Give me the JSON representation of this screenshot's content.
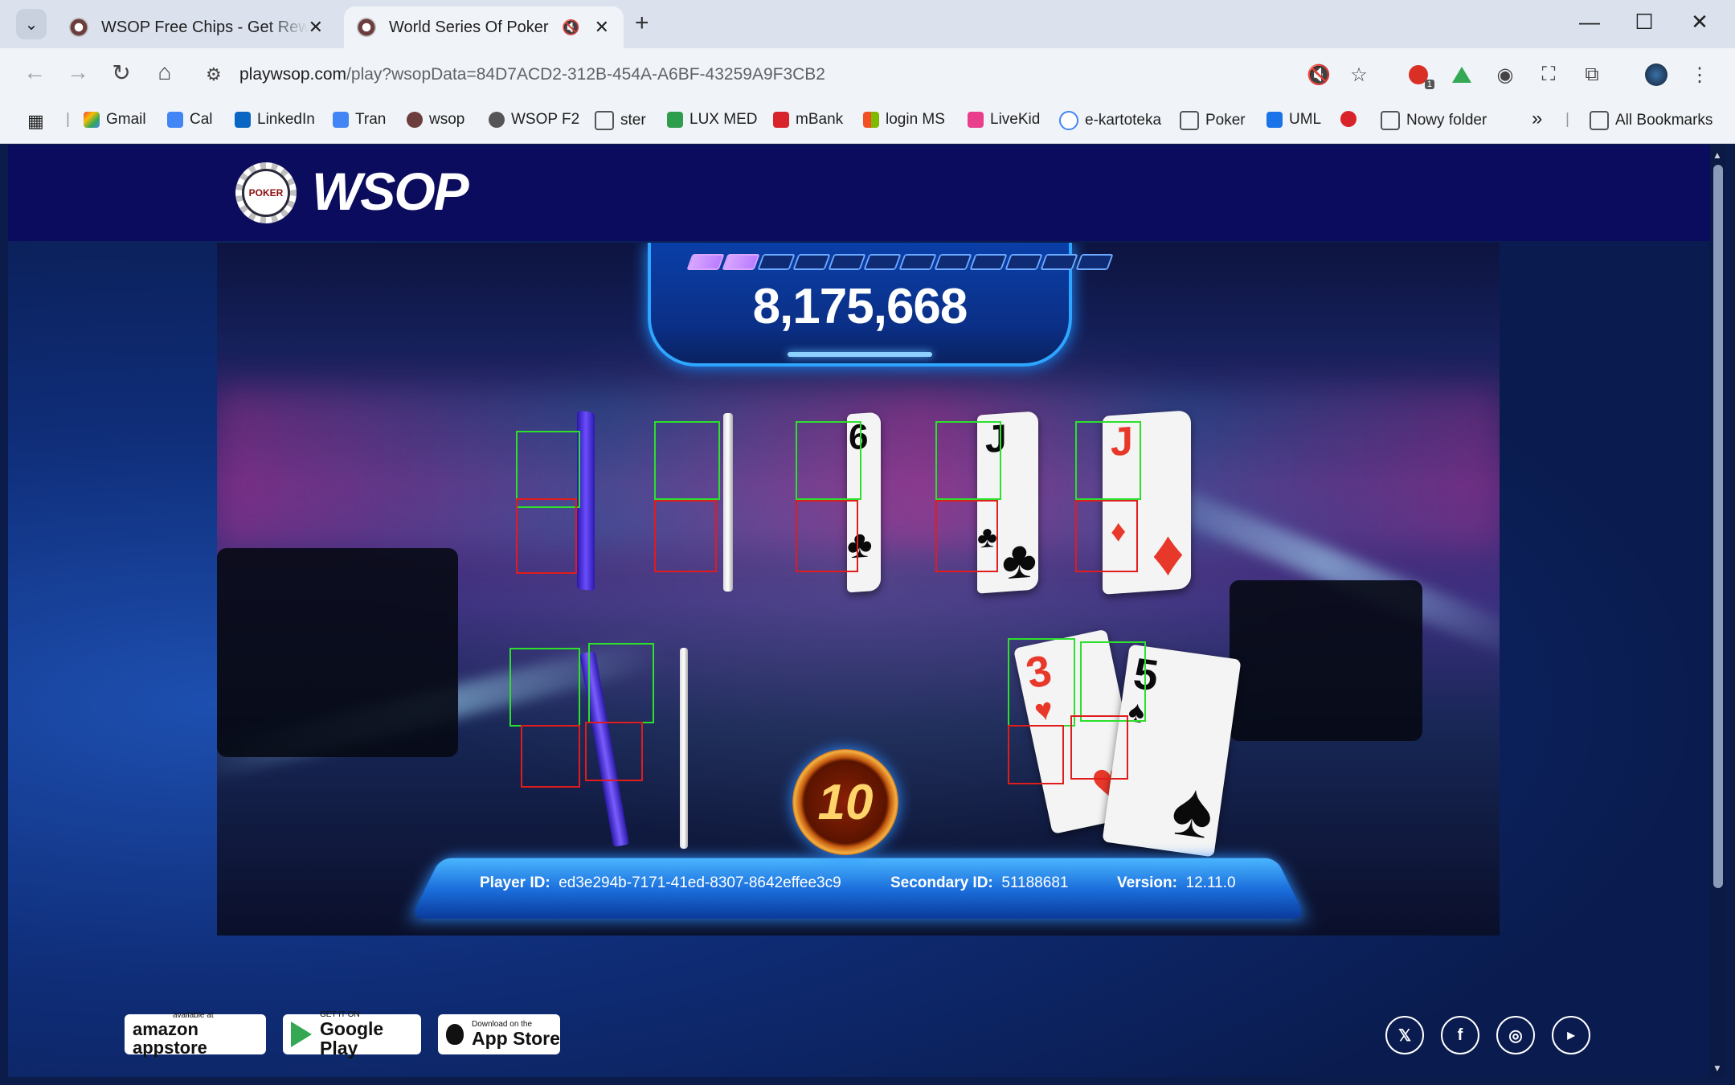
{
  "browser": {
    "tabs": [
      {
        "title": "WSOP Free Chips - Get Rewards",
        "active": false
      },
      {
        "title": "World Series Of Poker",
        "active": true
      }
    ],
    "url_domain": "playwsop.com",
    "url_path": "/play?wsopData=84D7ACD2-312B-454A-A6BF-43259A9F3CB2",
    "extension_badge": "1",
    "bookmarks": [
      "Gmail",
      "Cal",
      "LinkedIn",
      "Tran",
      "wsop",
      "WSOP F2",
      "ster",
      "LUX MED",
      "mBank",
      "login MS",
      "LiveKid",
      "e-kartoteka",
      "Poker",
      "UML",
      "Nowy folder"
    ],
    "all_bookmarks": "All Bookmarks",
    "more": "»"
  },
  "header": {
    "logo_text": "WSOP",
    "chip_text": "POKER"
  },
  "game": {
    "score": "8,175,668",
    "progress": {
      "filled": 2,
      "total": 12
    },
    "timer": "10",
    "community_cards": [
      {
        "rank": "",
        "suit": "",
        "face": "down"
      },
      {
        "rank": "",
        "suit": "",
        "face": "edge"
      },
      {
        "rank": "6",
        "suit": "♣",
        "color": "black"
      },
      {
        "rank": "J",
        "suit": "♣",
        "color": "black"
      },
      {
        "rank": "J",
        "suit": "♦",
        "color": "red"
      }
    ],
    "left_hand": [
      {
        "face": "down"
      },
      {
        "face": "edge"
      }
    ],
    "right_hand": [
      {
        "rank": "3",
        "suit": "♥",
        "color": "red"
      },
      {
        "rank": "5",
        "suit": "♠",
        "color": "black"
      }
    ]
  },
  "footer": {
    "player_id_label": "Player ID:",
    "player_id": "ed3e294b-7171-41ed-8307-8642effee3c9",
    "secondary_id_label": "Secondary ID:",
    "secondary_id": "51188681",
    "version_label": "Version:",
    "version": "12.11.0",
    "stores": [
      {
        "small": "available at",
        "big": "amazon appstore"
      },
      {
        "small": "GET IT ON",
        "big": "Google Play"
      },
      {
        "small": "Download on the",
        "big": "App Store"
      }
    ],
    "social": [
      "twitter-icon",
      "facebook-icon",
      "instagram-icon",
      "youtube-icon"
    ]
  }
}
